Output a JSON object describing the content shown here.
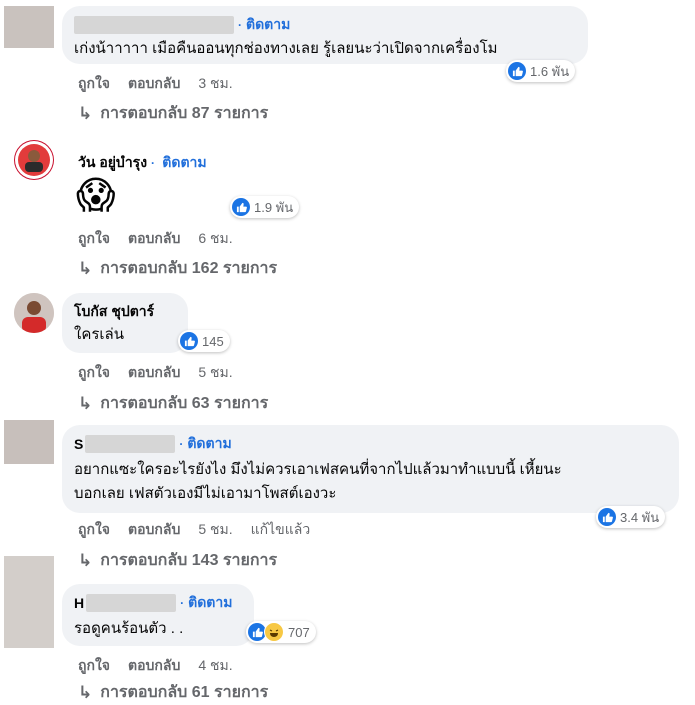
{
  "comments": [
    {
      "name": "",
      "follow": "ติดตาม",
      "text_lines": [
        "เก่งน้าาาาา เมือคืนออนทุกช่องทางเลย รู้เลยนะว่าเปิดจากเครื่องโม"
      ],
      "reaction_count": "1.6 พัน",
      "actions": {
        "like": "ถูกใจ",
        "reply": "ตอบกลับ",
        "time": "3 ชม."
      },
      "replies": "การตอบกลับ 87 รายการ"
    },
    {
      "name": "วัน อยู่บำรุง",
      "follow": "ติดตาม",
      "emoji": "😱",
      "reaction_count": "1.9 พัน",
      "actions": {
        "like": "ถูกใจ",
        "reply": "ตอบกลับ",
        "time": "6 ชม."
      },
      "replies": "การตอบกลับ 162 รายการ"
    },
    {
      "name": "โบกัส ชุปตาร์",
      "text_lines": [
        "ใครเล่น"
      ],
      "reaction_count": "145",
      "actions": {
        "like": "ถูกใจ",
        "reply": "ตอบกลับ",
        "time": "5 ชม."
      },
      "replies": "การตอบกลับ 63 รายการ"
    },
    {
      "name": "S",
      "follow": "ติดตาม",
      "text_lines": [
        "อยากแซะใครอะไรยังไง มึงไม่ควรเอาเฟสคนที่จากไปแล้วมาทำแบบนี้ เหี้ยนะ",
        "บอกเลย เฟสตัวเองมีไม่เอามาโพสต์เองวะ"
      ],
      "reaction_count": "3.4 พัน",
      "actions": {
        "like": "ถูกใจ",
        "reply": "ตอบกลับ",
        "time": "5 ชม.",
        "edited": "แก้ไขแล้ว"
      },
      "replies": "การตอบกลับ 143 รายการ"
    },
    {
      "name": "H",
      "follow": "ติดตาม",
      "text_lines": [
        "รอดูคนร้อนตัว . ."
      ],
      "reaction_count": "707",
      "actions": {
        "like": "ถูกใจ",
        "reply": "ตอบกลับ",
        "time": "4 ชม."
      },
      "replies": "การตอบกลับ 61 รายการ"
    }
  ],
  "icons": {
    "like": "thumbs-up-icon",
    "haha": "haha-icon",
    "reply_arrow": "reply-arrow-icon"
  },
  "colors": {
    "bubble": "#f0f2f5",
    "link": "#216fdb",
    "like": "#1b74e4",
    "muted": "#65676b"
  }
}
